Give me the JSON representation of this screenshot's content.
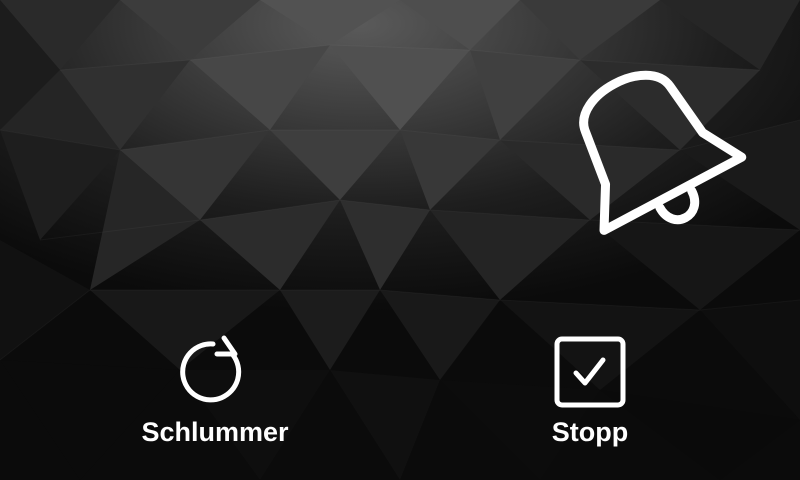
{
  "background": {
    "style": "low-poly-dark-gradient",
    "colors": [
      "#5a5a5a",
      "#2a2a2a",
      "#0b0b0b"
    ]
  },
  "alarm": {
    "icon": "bell-icon"
  },
  "actions": {
    "snooze": {
      "label": "Schlummer",
      "icon": "snooze-circular-arrow-icon"
    },
    "stop": {
      "label": "Stopp",
      "icon": "checkbox-checked-icon"
    }
  },
  "colors": {
    "foreground": "#ffffff"
  }
}
